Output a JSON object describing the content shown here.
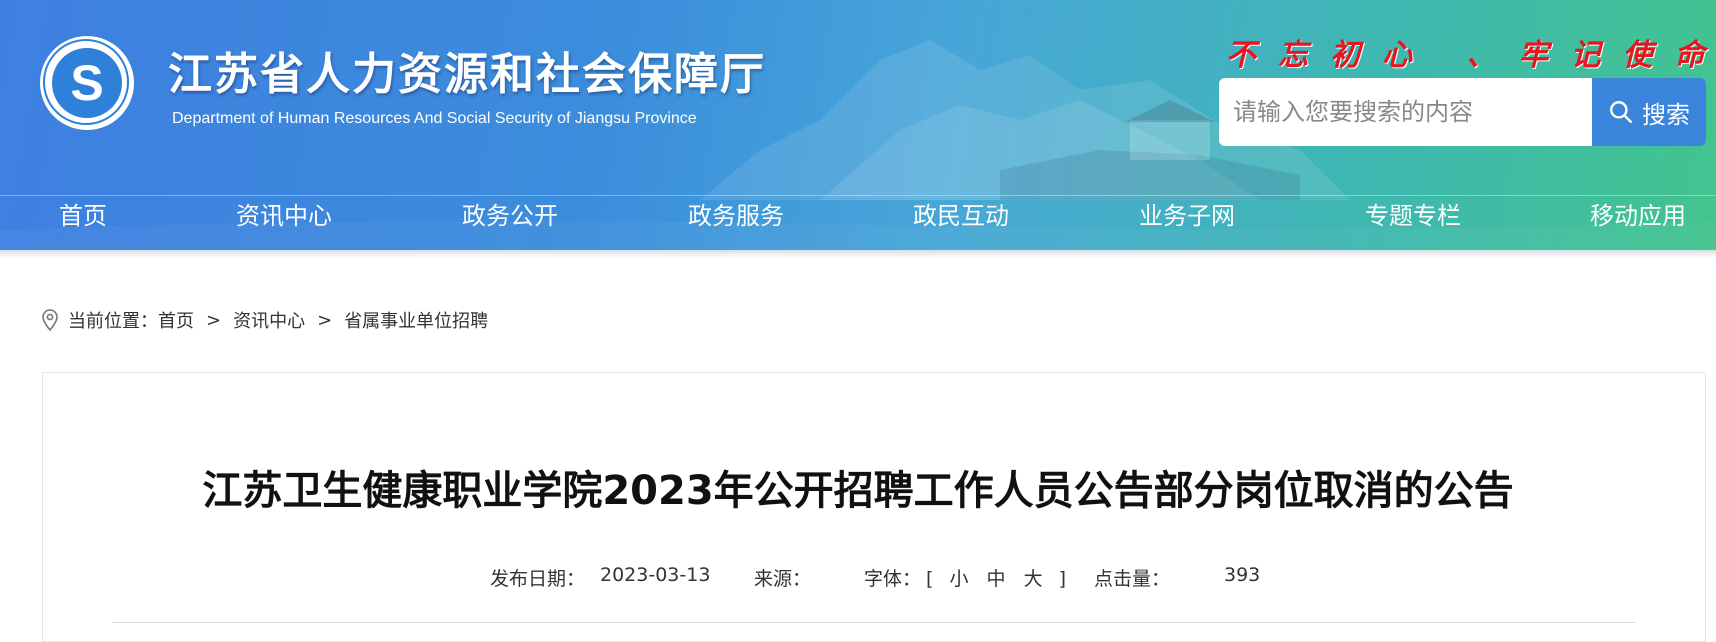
{
  "site": {
    "title": "江苏省人力资源和社会保障厅",
    "subtitle": "Department of Human Resources And Social Security of Jiangsu Province",
    "slogan": "不忘初心 、牢记使命"
  },
  "search": {
    "placeholder": "请输入您要搜索的内容",
    "button_label": "搜索",
    "icon": "search-icon"
  },
  "nav": {
    "items": [
      {
        "label": "首页"
      },
      {
        "label": "资讯中心"
      },
      {
        "label": "政务公开"
      },
      {
        "label": "政务服务"
      },
      {
        "label": "政民互动"
      },
      {
        "label": "业务子网"
      },
      {
        "label": "专题专栏"
      },
      {
        "label": "移动应用"
      }
    ]
  },
  "breadcrumb": {
    "icon": "location-pin-icon",
    "prefix": "当前位置：",
    "items": [
      "首页",
      "资讯中心",
      "省属事业单位招聘"
    ],
    "separator": ">"
  },
  "article": {
    "title": "江苏卫生健康职业学院2023年公开招聘工作人员公告部分岗位取消的公告",
    "date_label": "发布日期：",
    "date": "2023-03-13",
    "source_label": "来源：",
    "source": "",
    "font_label": "字体：",
    "font_open": "[",
    "font_small": "小",
    "font_medium": "中",
    "font_large": "大",
    "font_close": "]",
    "hits_label": "点击量：",
    "hits": "393"
  },
  "colors": {
    "header_start": "#3f7fe0",
    "header_end": "#42c48e",
    "slogan": "#e8141e",
    "search_button": "#3b84dc"
  }
}
